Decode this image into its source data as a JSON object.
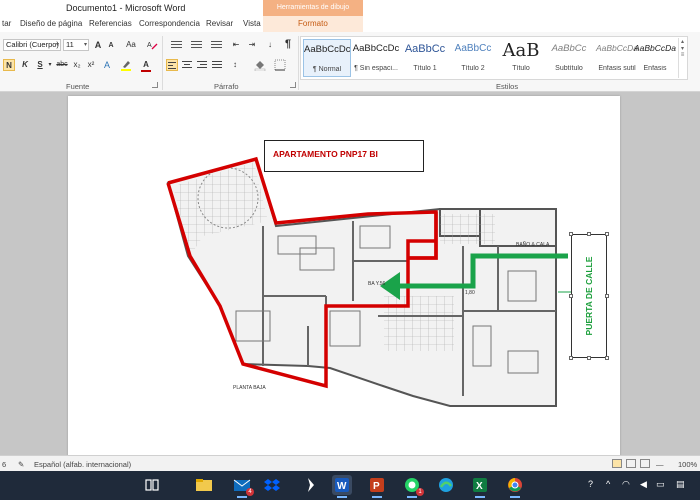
{
  "window": {
    "title": "Documento1 - Microsoft Word",
    "context_tab_header": "Herramientas de dibujo"
  },
  "ribbon_tabs": [
    {
      "label": "tar"
    },
    {
      "label": "Diseño de página"
    },
    {
      "label": "Referencias"
    },
    {
      "label": "Correspondencia"
    },
    {
      "label": "Revisar"
    },
    {
      "label": "Vista"
    },
    {
      "label": "Formato"
    }
  ],
  "ribbon": {
    "font_name": "Calibri (Cuerpo)",
    "font_size": "11",
    "groups": {
      "fuente": "Fuente",
      "parrafo": "Párrafo",
      "estilos": "Estilos"
    },
    "font_buttons": {
      "grow": "A",
      "shrink": "A",
      "case": "Aa",
      "bold": "N",
      "italic": "K",
      "underline": "S",
      "strike": "abc",
      "subscript": "x₂",
      "superscript": "x²",
      "color": "A"
    },
    "paragraph_buttons": {
      "show_marks": "¶"
    },
    "styles": [
      {
        "preview": "AaBbCcDc",
        "name": "¶ Normal"
      },
      {
        "preview": "AaBbCcDc",
        "name": "¶ Sin espaci..."
      },
      {
        "preview": "AaBbCc",
        "name": "Título 1"
      },
      {
        "preview": "AaBbCc",
        "name": "Título 2"
      },
      {
        "preview": "AaB",
        "name": "Título"
      },
      {
        "preview": "AaBbCc",
        "name": "Subtítulo"
      },
      {
        "preview": "AaBbCcDa",
        "name": "Énfasis sutil"
      },
      {
        "preview": "AaBbCcDa",
        "name": "Énfasis"
      }
    ]
  },
  "document": {
    "callout_text": "APARTAMENTO PNP17 BI",
    "street_label": "PUERTA DE CALLE",
    "plan_label": "PLANTA BAJA",
    "room_labels": [
      "BA Y.56",
      "BAÑO & CALA",
      "1,80"
    ]
  },
  "colors": {
    "outline": "#d40000",
    "arrow": "#1aa34a",
    "ribbon_active": "#fce4a8",
    "context_tab": "#f4b183"
  },
  "statusbar": {
    "page_indicator": "6",
    "language": "Español (alfab. internacional)",
    "zoom": "100%"
  },
  "taskbar": {
    "apps": [
      {
        "name": "task-view-icon"
      },
      {
        "name": "file-explorer-icon"
      },
      {
        "name": "mail-icon",
        "badge": "4"
      },
      {
        "name": "dropbox-icon"
      },
      {
        "name": "vpn-icon"
      },
      {
        "name": "word-icon"
      },
      {
        "name": "powerpoint-icon"
      },
      {
        "name": "whatsapp-icon",
        "badge": "1"
      },
      {
        "name": "edge-icon"
      },
      {
        "name": "excel-icon"
      },
      {
        "name": "chrome-icon"
      }
    ]
  }
}
